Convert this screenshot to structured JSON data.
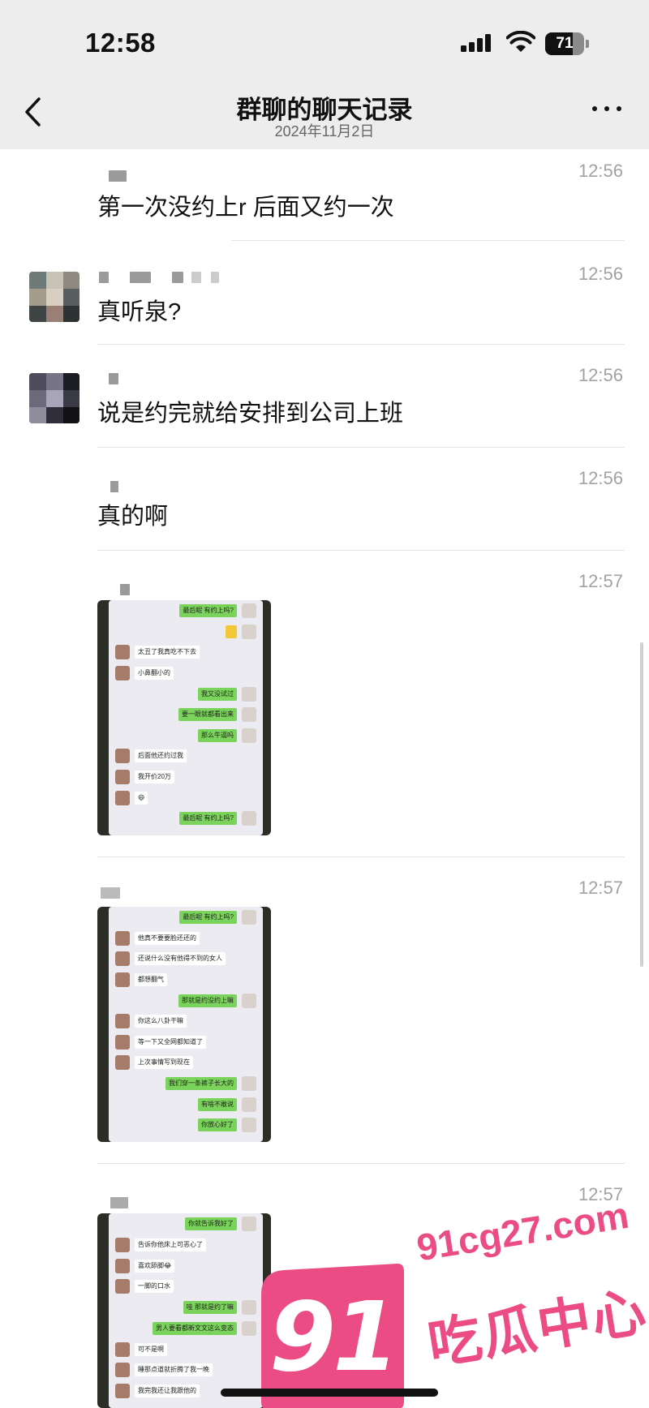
{
  "status_bar": {
    "time": "12:58",
    "battery": "71",
    "battery_level": 0.71
  },
  "nav": {
    "title": "群聊的聊天记录",
    "date": "2024年11月2日"
  },
  "messages": [
    {
      "time": "12:56",
      "text": "第一次没约上r 后面又约一次"
    },
    {
      "time": "12:56",
      "text": "真听泉?"
    },
    {
      "time": "12:56",
      "text": "说是约完就给安排到公司上班"
    },
    {
      "time": "12:56",
      "text": "真的啊"
    },
    {
      "time": "12:57",
      "lines": [
        [
          "out",
          "最后呢 有约上吗?"
        ],
        [
          "out",
          ""
        ],
        [
          "in",
          "太丑了我真吃不下去"
        ],
        [
          "in",
          "小鼻翻小的"
        ],
        [
          "out",
          "我又没试过"
        ],
        [
          "out",
          "要一眼就都看出来"
        ],
        [
          "out",
          "那么牛逼吗"
        ],
        [
          "in",
          "后面他还约过我"
        ],
        [
          "in",
          "我开价20万"
        ],
        [
          "in",
          "😄"
        ],
        [
          "out",
          "最后呢 有约上吗?"
        ]
      ]
    },
    {
      "time": "12:57",
      "lines": [
        [
          "out",
          "最后呢 有约上吗?"
        ],
        [
          "in",
          "他真不要要脸还还的"
        ],
        [
          "in",
          "还说什么没有他得不到的女人"
        ],
        [
          "in",
          "都想翻气"
        ],
        [
          "out",
          "那就是约没约上嘛"
        ],
        [
          "in",
          "你这么八卦干嘛"
        ],
        [
          "in",
          "等一下又全网都知道了"
        ],
        [
          "in",
          "上次事情写到现在"
        ],
        [
          "out",
          "我们穿一条裤子长大的"
        ],
        [
          "out",
          "有啥不敢说"
        ],
        [
          "out",
          "你放心好了"
        ]
      ]
    },
    {
      "time": "12:57",
      "lines": [
        [
          "out",
          "你就告诉我好了"
        ],
        [
          "in",
          "告诉你他床上可恶心了"
        ],
        [
          "in",
          "喜欢舔脚😂"
        ],
        [
          "in",
          "一脚的口水"
        ],
        [
          "out",
          "哇 那就是约了嘛"
        ],
        [
          "out",
          "男人要看都新文文这么变态"
        ],
        [
          "in",
          "可不是啊"
        ],
        [
          "in",
          "睡那点道就折腾了我一晚"
        ],
        [
          "in",
          "我完我还让我跟他的"
        ]
      ]
    }
  ],
  "watermark": {
    "logo": "91",
    "url": "91cg27.com",
    "name": "吃瓜中心",
    "color": "#ec4c84"
  }
}
